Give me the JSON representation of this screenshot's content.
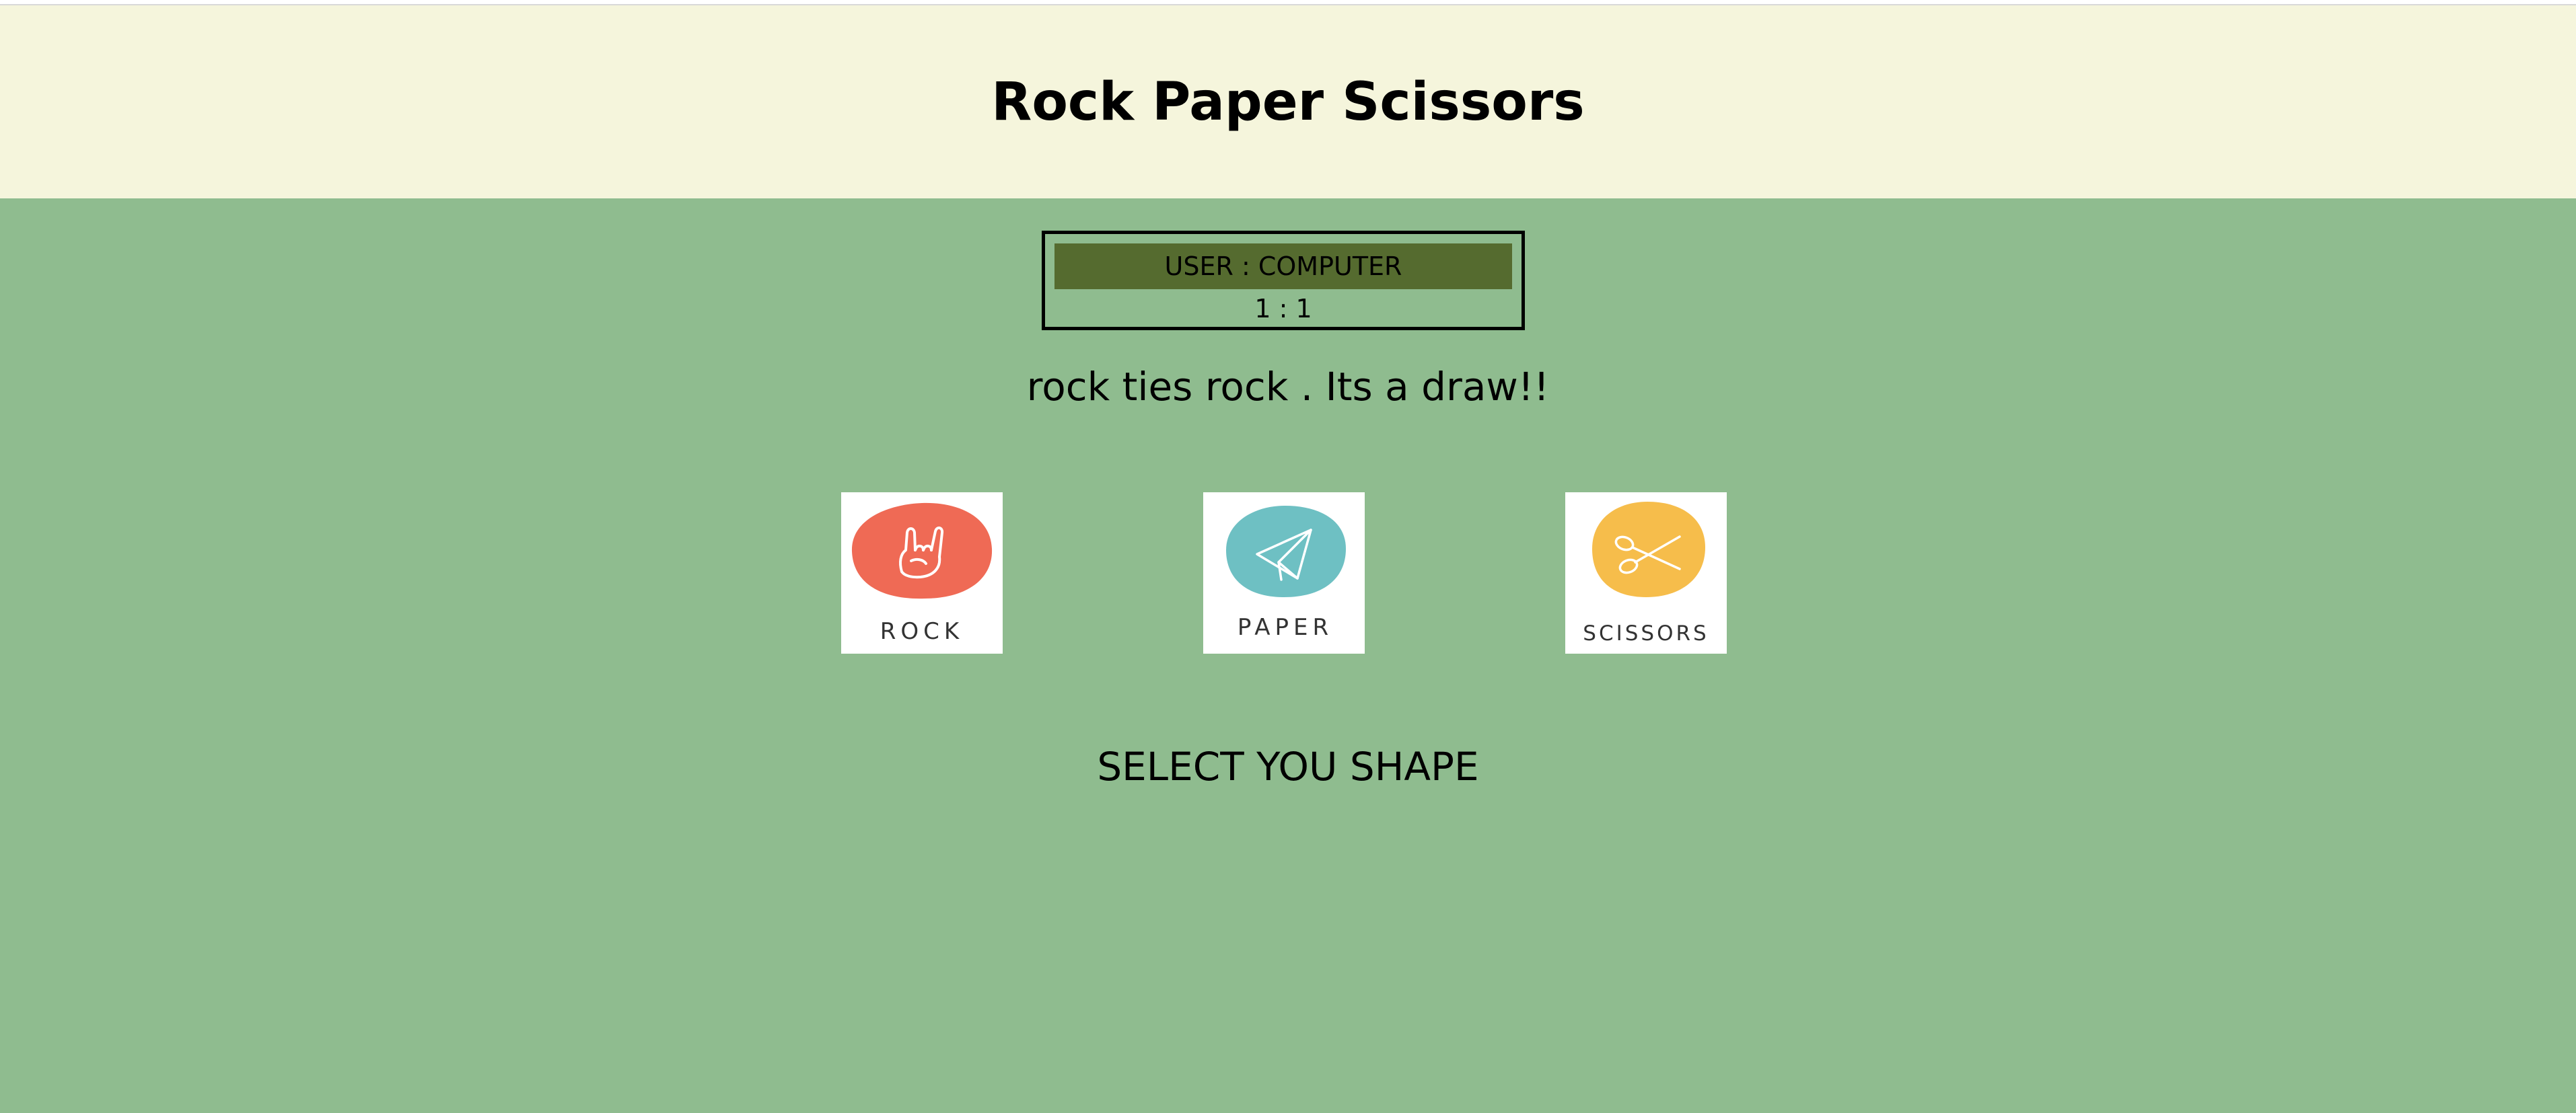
{
  "header": {
    "title": "Rock Paper Scissors"
  },
  "scoreboard": {
    "label": "USER : COMPUTER",
    "score": "1 : 1"
  },
  "result_message": "rock ties rock . Its a draw!!",
  "choices": [
    {
      "id": "rock",
      "label": "ROCK",
      "icon": "rock-hand-icon",
      "color": "#ef6a55"
    },
    {
      "id": "paper",
      "label": "PAPER",
      "icon": "paper-plane-icon",
      "color": "#6ec0c3"
    },
    {
      "id": "scissors",
      "label": "SCISSORS",
      "icon": "scissors-icon",
      "color": "#f6bd4b"
    }
  ],
  "prompt": "SELECT YOU SHAPE",
  "colors": {
    "header_bg": "#f5f5dc",
    "page_bg": "#8fbc8f",
    "badge_bg": "#556b2f"
  }
}
